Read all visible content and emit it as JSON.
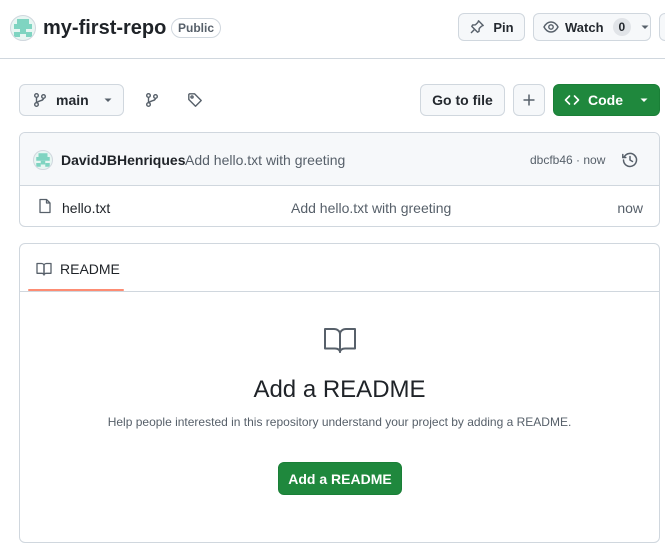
{
  "repo": {
    "name": "my-first-repo",
    "visibility": "Public"
  },
  "header_actions": {
    "pin_label": "Pin",
    "watch_label": "Watch",
    "watch_count": "0"
  },
  "toolbar": {
    "branch_name": "main",
    "go_to_file_label": "Go to file",
    "code_label": "Code"
  },
  "commit": {
    "author": "DavidJBHenriques",
    "message": "Add hello.txt with greeting",
    "sha_time": "dbcfb46 · now"
  },
  "files": [
    {
      "name": "hello.txt",
      "message": "Add hello.txt with greeting",
      "time": "now"
    }
  ],
  "readme": {
    "tab_label": "README",
    "title": "Add a README",
    "description": "Help people interested in this repository understand your project by adding a README.",
    "button_label": "Add a README"
  },
  "colors": {
    "primary_green": "#1f883d",
    "tab_underline": "#fd8c73",
    "avatar_teal": "#7fd4c1"
  }
}
